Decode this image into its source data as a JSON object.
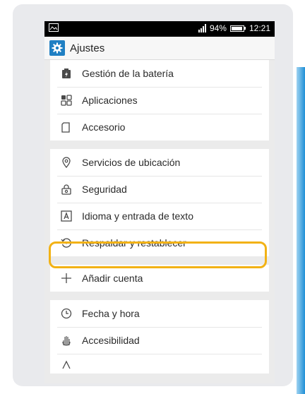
{
  "status": {
    "battery": "94%",
    "time": "12:21"
  },
  "titlebar": {
    "title": "Ajustes"
  },
  "groups": [
    {
      "items": [
        {
          "label": "Gestión de la batería",
          "icon": "battery-manager-icon"
        },
        {
          "label": "Aplicaciones",
          "icon": "apps-icon"
        },
        {
          "label": "Accesorio",
          "icon": "accessory-icon"
        }
      ]
    },
    {
      "items": [
        {
          "label": "Servicios de ubicación",
          "icon": "location-icon"
        },
        {
          "label": "Seguridad",
          "icon": "lock-icon"
        },
        {
          "label": "Idioma y entrada de texto",
          "icon": "language-icon"
        },
        {
          "label": "Respaldar y restablecer",
          "icon": "backup-restore-icon"
        }
      ]
    },
    {
      "items": [
        {
          "label": "Añadir cuenta",
          "icon": "plus-icon"
        }
      ]
    },
    {
      "items": [
        {
          "label": "Fecha y hora",
          "icon": "clock-icon"
        },
        {
          "label": "Accesibilidad",
          "icon": "accessibility-hand-icon"
        },
        {
          "label": "",
          "icon": "partial-icon"
        }
      ]
    }
  ],
  "colors": {
    "highlight": "#f2b215",
    "accent": "#1f7fc3"
  }
}
